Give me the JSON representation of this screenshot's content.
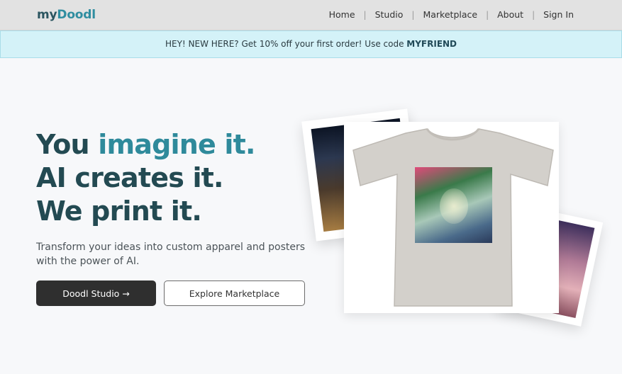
{
  "header": {
    "logo_part1": "my",
    "logo_part2": "Doodl",
    "nav": {
      "home": "Home",
      "studio": "Studio",
      "marketplace": "Marketplace",
      "about": "About",
      "signin": "Sign In",
      "separator": "|"
    }
  },
  "promo": {
    "text": "HEY! NEW HERE? Get 10% off your first order! Use code ",
    "code": "MYFRIEND"
  },
  "hero": {
    "line1_a": "You ",
    "line1_b": "imagine it.",
    "line2": "AI creates it.",
    "line3": "We print it.",
    "subtitle": "Transform your ideas into custom apparel and posters with the power of AI.",
    "primary_button": "Doodl Studio →",
    "secondary_button": "Explore Marketplace"
  },
  "colors": {
    "brand_dark": "#234a52",
    "brand_accent": "#2f8a9b",
    "promo_bg": "#d4f2f8",
    "primary_button_bg": "#2f2f2f"
  }
}
